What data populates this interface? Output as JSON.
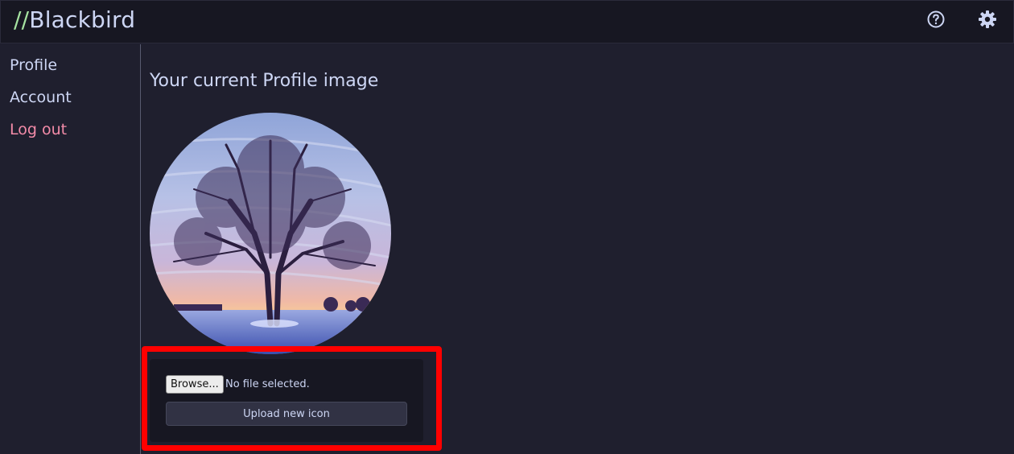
{
  "app": {
    "logo_prefix": "//",
    "logo_name": "Blackbird",
    "colors": {
      "accent_green": "#a6e3a1",
      "logout_red": "#f38ba8",
      "highlight": "#ff0000"
    }
  },
  "header": {
    "icons": [
      "help-circle-icon",
      "gear-icon"
    ]
  },
  "sidebar": {
    "items": [
      {
        "label": "Profile"
      },
      {
        "label": "Account"
      },
      {
        "label": "Log out"
      }
    ]
  },
  "main": {
    "title": "Your current Profile image",
    "upload": {
      "browse_label": "Browse...",
      "file_status": "No file selected.",
      "upload_label": "Upload new icon"
    }
  }
}
